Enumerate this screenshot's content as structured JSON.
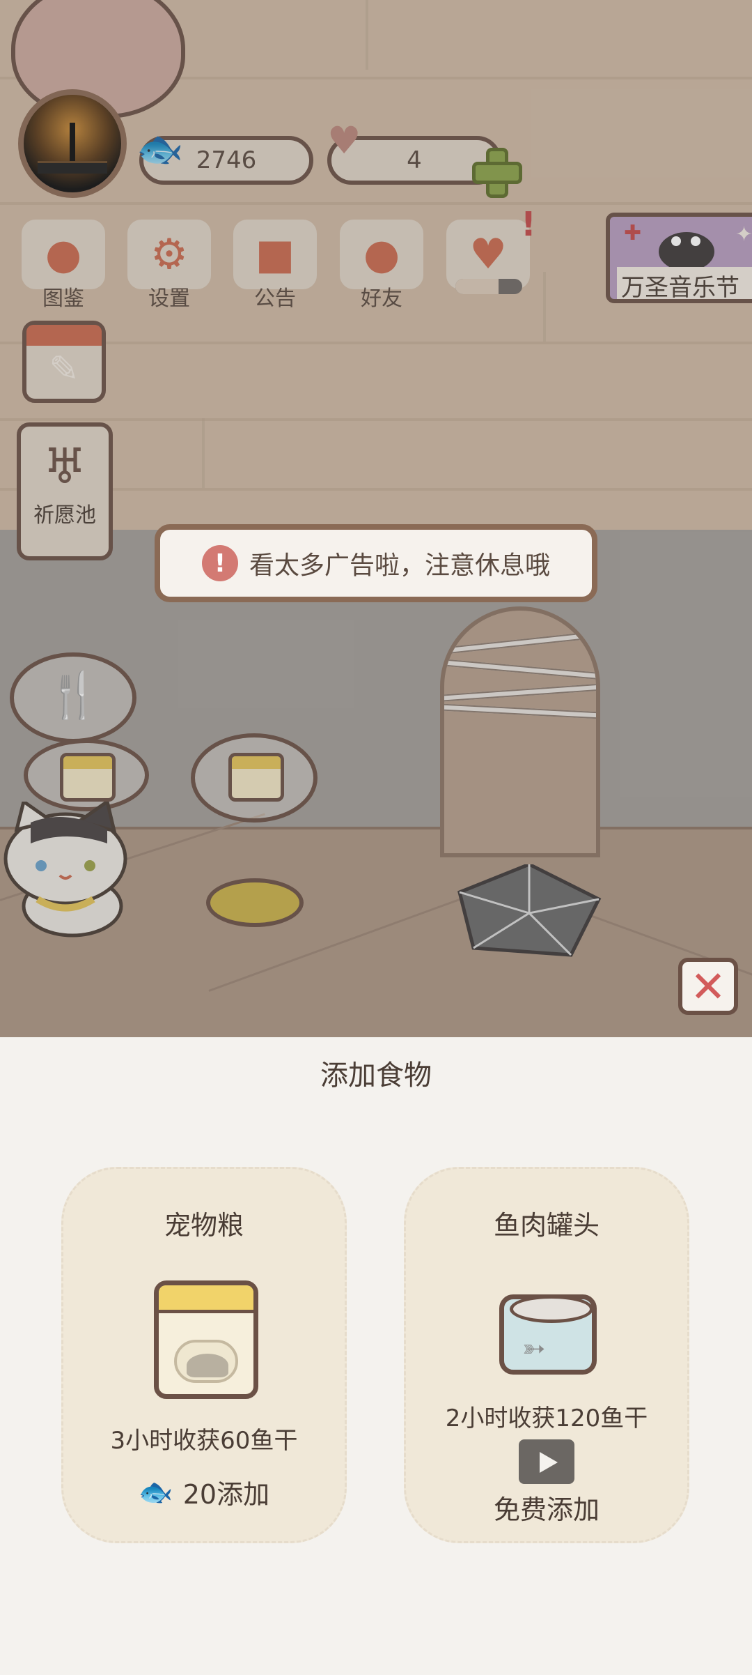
{
  "hud": {
    "fish_count": "2746",
    "heart_count": "4",
    "fish_icon": "fish-icon",
    "heart_icon": "heart-icon",
    "energy_level": 0.65
  },
  "menu": {
    "tujian": "图鉴",
    "shezhi": "设置",
    "gonggao": "公告",
    "haoyou": "好友"
  },
  "event_banner": {
    "label": "万圣音乐节"
  },
  "side": {
    "wish_pool": "祈愿池"
  },
  "toast": {
    "message": "看太多广告啦，注意休息哦"
  },
  "panel": {
    "title": "添加食物",
    "cards": [
      {
        "name": "宠物粮",
        "desc": "3小时收获60鱼干",
        "action": "20添加"
      },
      {
        "name": "鱼肉罐头",
        "desc": "2小时收获120鱼干",
        "action": "免费添加"
      }
    ]
  },
  "colors": {
    "accent_red": "#d25b5b",
    "plus_green": "#8aa24a",
    "outline": "#6b5146"
  }
}
